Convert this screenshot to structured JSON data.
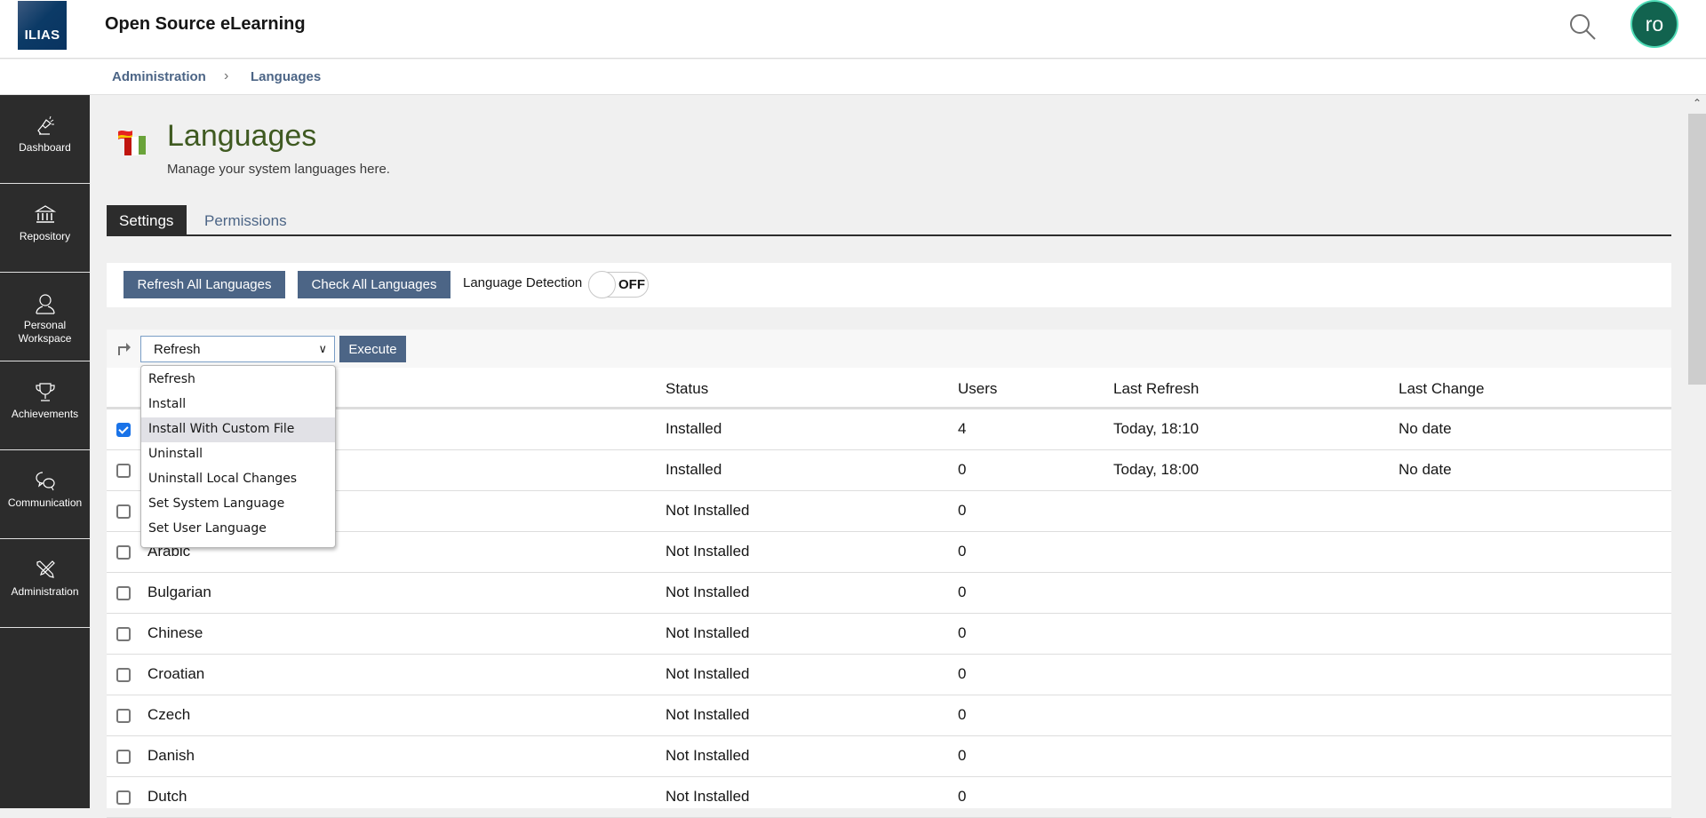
{
  "header": {
    "logo_text": "ILIAS",
    "site_title": "Open Source eLearning",
    "search_icon": "search-icon",
    "avatar_initials": "ro",
    "avatar_bg": "#12634f"
  },
  "breadcrumb": {
    "items": [
      "Administration",
      "Languages"
    ],
    "separator": ">"
  },
  "sidebar": {
    "items": [
      {
        "label": "Dashboard",
        "icon": "dashboard-lamp-icon"
      },
      {
        "label": "Repository",
        "icon": "repository-building-icon"
      },
      {
        "label": "Personal Workspace",
        "icon": "person-icon"
      },
      {
        "label": "Achievements",
        "icon": "trophy-icon"
      },
      {
        "label": "Communication",
        "icon": "chat-bubbles-icon"
      },
      {
        "label": "Administration",
        "icon": "tools-icon"
      }
    ]
  },
  "page": {
    "title": "Languages",
    "description": "Manage your system languages here.",
    "icon": "languages-flags-icon"
  },
  "tabs": [
    {
      "label": "Settings",
      "active": true
    },
    {
      "label": "Permissions",
      "active": false
    }
  ],
  "toolbar": {
    "refresh_all_label": "Refresh All Languages",
    "check_all_label": "Check All Languages",
    "language_detection_label": "Language Detection",
    "language_detection_state": "OFF"
  },
  "actions": {
    "selected": "Refresh",
    "execute_label": "Execute",
    "options": [
      "Refresh",
      "Install",
      "Install With Custom File",
      "Uninstall",
      "Uninstall Local Changes",
      "Set System Language",
      "Set User Language"
    ],
    "highlighted_option": "Install With Custom File"
  },
  "table": {
    "columns": [
      "",
      "Status",
      "Users",
      "Last Refresh",
      "Last Change"
    ],
    "rows": [
      {
        "checked": true,
        "name": "",
        "status": "Installed",
        "users": "4",
        "last_refresh": "Today, 18:10",
        "last_change": "No date"
      },
      {
        "checked": false,
        "name": "",
        "status": "Installed",
        "users": "0",
        "last_refresh": "Today, 18:00",
        "last_change": "No date"
      },
      {
        "checked": false,
        "name": "",
        "status": "Not Installed",
        "users": "0",
        "last_refresh": "",
        "last_change": ""
      },
      {
        "checked": false,
        "name": "Arabic",
        "status": "Not Installed",
        "users": "0",
        "last_refresh": "",
        "last_change": ""
      },
      {
        "checked": false,
        "name": "Bulgarian",
        "status": "Not Installed",
        "users": "0",
        "last_refresh": "",
        "last_change": ""
      },
      {
        "checked": false,
        "name": "Chinese",
        "status": "Not Installed",
        "users": "0",
        "last_refresh": "",
        "last_change": ""
      },
      {
        "checked": false,
        "name": "Croatian",
        "status": "Not Installed",
        "users": "0",
        "last_refresh": "",
        "last_change": ""
      },
      {
        "checked": false,
        "name": "Czech",
        "status": "Not Installed",
        "users": "0",
        "last_refresh": "",
        "last_change": ""
      },
      {
        "checked": false,
        "name": "Danish",
        "status": "Not Installed",
        "users": "0",
        "last_refresh": "",
        "last_change": ""
      },
      {
        "checked": false,
        "name": "Dutch",
        "status": "Not Installed",
        "users": "0",
        "last_refresh": "",
        "last_change": ""
      }
    ]
  }
}
